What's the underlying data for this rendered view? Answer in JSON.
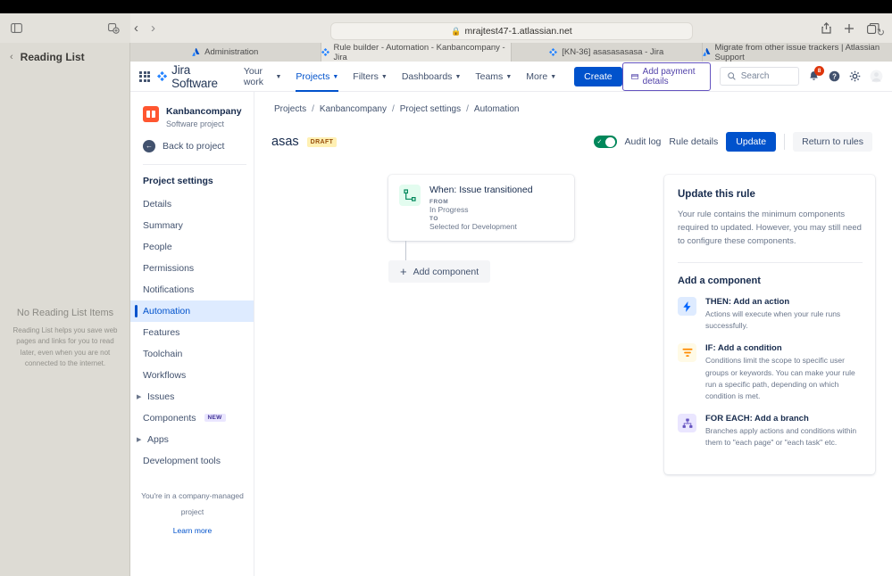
{
  "browser": {
    "url": "mrajtest47-1.atlassian.net",
    "lock_icon": "lock-icon",
    "reload_icon": "reload-icon",
    "back_icon": "back-arrow-icon",
    "forward_icon": "forward-arrow-icon",
    "sidebar_toggle_icon": "sidebar-toggle-icon",
    "new_tab_group_icon": "new-tab-group-icon",
    "share_icon": "share-icon",
    "plus_icon": "new-tab-icon",
    "tab_overview_icon": "tab-overview-icon",
    "tabs": [
      {
        "title": "Administration",
        "favicon": "atlassian-icon",
        "active": false
      },
      {
        "title": "Rule builder - Automation - Kanbancompany - Jira",
        "favicon": "jira-icon",
        "active": true
      },
      {
        "title": "[KN-36] asasasasasa - Jira",
        "favicon": "jira-icon",
        "active": false
      },
      {
        "title": "Migrate from other issue trackers | Atlassian Support",
        "favicon": "atlassian-icon",
        "active": false
      }
    ]
  },
  "reading_list": {
    "back_icon": "chevron-left-icon",
    "title": "Reading List",
    "empty_title": "No Reading List Items",
    "empty_body": "Reading List helps you save web pages and links for you to read later, even when you are not connected to the internet."
  },
  "jira_nav": {
    "app_switcher_icon": "app-switcher-icon",
    "logo_icon": "jira-logo-icon",
    "logo_text": "Jira Software",
    "items": [
      {
        "label": "Your work",
        "has_caret": true,
        "selected": false
      },
      {
        "label": "Projects",
        "has_caret": true,
        "selected": true
      },
      {
        "label": "Filters",
        "has_caret": true,
        "selected": false
      },
      {
        "label": "Dashboards",
        "has_caret": true,
        "selected": false
      },
      {
        "label": "Teams",
        "has_caret": true,
        "selected": false
      },
      {
        "label": "More",
        "has_caret": true,
        "selected": false
      }
    ],
    "create_label": "Create",
    "payment_label": "Add payment details",
    "payment_icon": "credit-card-icon",
    "search_placeholder": "Search",
    "search_icon": "search-icon",
    "notifications_icon": "bell-icon",
    "notifications_count": "8",
    "help_icon": "help-icon",
    "settings_icon": "gear-icon",
    "avatar_icon": "avatar"
  },
  "project_sidebar": {
    "project_name": "Kanbancompany",
    "project_type": "Software project",
    "project_avatar_icon": "project-avatar-icon",
    "back_icon": "back-arrow-circle-icon",
    "back_label": "Back to project",
    "section_title": "Project settings",
    "items": [
      {
        "label": "Details",
        "active": false,
        "expandable": false,
        "tag": ""
      },
      {
        "label": "Summary",
        "active": false,
        "expandable": false,
        "tag": ""
      },
      {
        "label": "People",
        "active": false,
        "expandable": false,
        "tag": ""
      },
      {
        "label": "Permissions",
        "active": false,
        "expandable": false,
        "tag": ""
      },
      {
        "label": "Notifications",
        "active": false,
        "expandable": false,
        "tag": ""
      },
      {
        "label": "Automation",
        "active": true,
        "expandable": false,
        "tag": ""
      },
      {
        "label": "Features",
        "active": false,
        "expandable": false,
        "tag": ""
      },
      {
        "label": "Toolchain",
        "active": false,
        "expandable": false,
        "tag": ""
      },
      {
        "label": "Workflows",
        "active": false,
        "expandable": false,
        "tag": ""
      },
      {
        "label": "Issues",
        "active": false,
        "expandable": true,
        "tag": ""
      },
      {
        "label": "Components",
        "active": false,
        "expandable": false,
        "tag": "NEW"
      },
      {
        "label": "Apps",
        "active": false,
        "expandable": true,
        "tag": ""
      },
      {
        "label": "Development tools",
        "active": false,
        "expandable": false,
        "tag": ""
      }
    ],
    "managed_text": "You're in a company-managed project",
    "managed_link": "Learn more"
  },
  "breadcrumb": {
    "items": [
      "Projects",
      "Kanbancompany",
      "Project settings",
      "Automation"
    ],
    "separator": "/"
  },
  "rule_header": {
    "title": "asas",
    "status_badge": "DRAFT",
    "toggle_on": true,
    "toggle_icon": "check-icon",
    "audit_log_label": "Audit log",
    "rule_details_label": "Rule details",
    "update_label": "Update",
    "return_label": "Return to rules"
  },
  "flow": {
    "trigger": {
      "icon": "trigger-transition-icon",
      "title": "When: Issue transitioned",
      "from_label": "FROM",
      "from_value": "In Progress",
      "to_label": "TO",
      "to_value": "Selected for Development"
    },
    "add_component_label": "Add component",
    "add_component_icon": "plus-icon"
  },
  "right_panel": {
    "title": "Update this rule",
    "description": "Your rule contains the minimum components required to updated. However, you may still need to configure these components.",
    "subtitle": "Add a component",
    "components": [
      {
        "icon": "lightning-bolt-icon",
        "icon_bg": "#deebff",
        "icon_color": "#0065ff",
        "title": "THEN: Add an action",
        "desc": "Actions will execute when your rule runs successfully."
      },
      {
        "icon": "filter-icon",
        "icon_bg": "#fffae6",
        "icon_color": "#ff8b00",
        "title": "IF: Add a condition",
        "desc": "Conditions limit the scope to specific user groups or keywords. You can make your rule run a specific path, depending on which condition is met."
      },
      {
        "icon": "branch-icon",
        "icon_bg": "#eae6ff",
        "icon_color": "#6554c0",
        "title": "FOR EACH: Add a branch",
        "desc": "Branches apply actions and conditions within them to \"each page\" or \"each task\" etc."
      }
    ]
  },
  "colors": {
    "brand_blue": "#0052cc",
    "toggle_green": "#00875a",
    "draft_yellow": "#fff0b3",
    "badge_red": "#de350b"
  }
}
